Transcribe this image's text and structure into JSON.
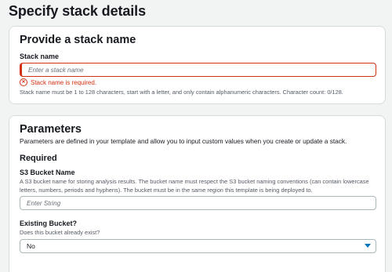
{
  "page": {
    "title": "Specify stack details"
  },
  "stack_name_panel": {
    "heading": "Provide a stack name",
    "field_label": "Stack name",
    "placeholder": "Enter a stack name",
    "value": "",
    "error": "Stack name is required.",
    "hint": "Stack name must be 1 to 128 characters, start with a letter, and only contain alphanumeric characters. Character count: 0/128."
  },
  "parameters_panel": {
    "heading": "Parameters",
    "description": "Parameters are defined in your template and allow you to input custom values when you create or update a stack.",
    "required_heading": "Required",
    "s3_bucket": {
      "label": "S3 Bucket Name",
      "description": "A S3 bucket name for storing analysis results. The bucket name must respect the S3 bucket naming conventions (can contain lowercase letters, numbers, periods and hyphens). The bucket must be in the same region this template is being deployed to.",
      "placeholder": "Enter String",
      "value": ""
    },
    "existing_bucket": {
      "label": "Existing Bucket?",
      "description": "Does this bucket already exist?",
      "selected": "No"
    }
  },
  "colors": {
    "error": "#d13212",
    "accent": "#0073bb"
  },
  "icons": {
    "error": "error-circle-icon",
    "dropdown": "caret-down-icon"
  }
}
